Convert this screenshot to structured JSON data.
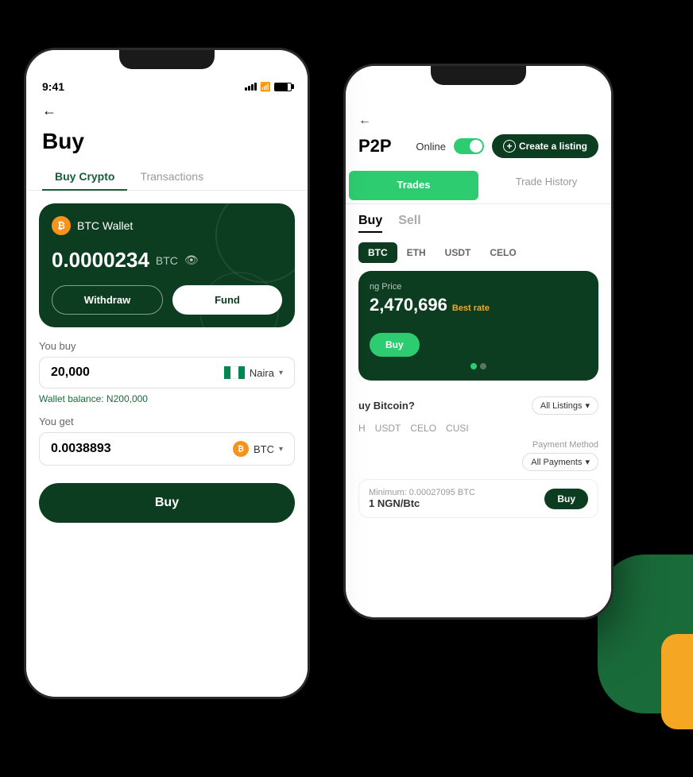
{
  "background": {
    "color": "#000"
  },
  "phoneFront": {
    "statusBar": {
      "time": "9:41",
      "battery": "80%"
    },
    "backLabel": "←",
    "title": "Buy",
    "tabs": [
      {
        "label": "Buy Crypto",
        "active": true
      },
      {
        "label": "Transactions",
        "active": false
      }
    ],
    "walletCard": {
      "iconLabel": "₿",
      "walletName": "BTC Wallet",
      "balance": "0.0000234",
      "currency": "BTC",
      "withdrawLabel": "Withdraw",
      "fundLabel": "Fund"
    },
    "youBuyLabel": "You buy",
    "buyAmount": "20,000",
    "currencyFlag": "NG",
    "currencyName": "Naira",
    "walletBalanceHint": "Wallet balance: N200,000",
    "youGetLabel": "You get",
    "getAmount": "0.0038893",
    "getCurrency": "BTC",
    "buyButtonLabel": "Buy"
  },
  "phoneBack": {
    "backLabel": "←",
    "title": "P2P",
    "onlineLabel": "Online",
    "createListingLabel": "Create a listing",
    "tabs": [
      {
        "label": "Trades",
        "active": true
      },
      {
        "label": "Trade History",
        "active": false
      }
    ],
    "buySellTabs": [
      {
        "label": "Buy",
        "active": true
      },
      {
        "label": "Sell",
        "active": false
      }
    ],
    "cryptoTabs": [
      {
        "label": "BTC",
        "active": true
      },
      {
        "label": "ETH",
        "active": false
      },
      {
        "label": "USDT",
        "active": false
      },
      {
        "label": "CELO",
        "active": false
      }
    ],
    "priceCard": {
      "label": "ng Price",
      "amount": "2,470,696",
      "bestRateLabel": "Best rate",
      "buyBtnLabel": "Buy"
    },
    "indicators": [
      {
        "active": true
      },
      {
        "active": false
      }
    ],
    "whyBuyTitle": "uy Bitcoin?",
    "allListingsLabel": "All Listings",
    "filterTabs": [
      {
        "label": "H",
        "active": false
      },
      {
        "label": "USDT",
        "active": false
      },
      {
        "label": "CELO",
        "active": false
      },
      {
        "label": "CUSI",
        "active": false
      }
    ],
    "paymentMethodLabel": "Payment Method",
    "allPaymentsLabel": "All Payments",
    "listingMinLabel": "Minimum: 0.00027095 BTC",
    "listingRateLabel": "1 NGN/Btc",
    "listingBuyLabel": "Buy"
  }
}
